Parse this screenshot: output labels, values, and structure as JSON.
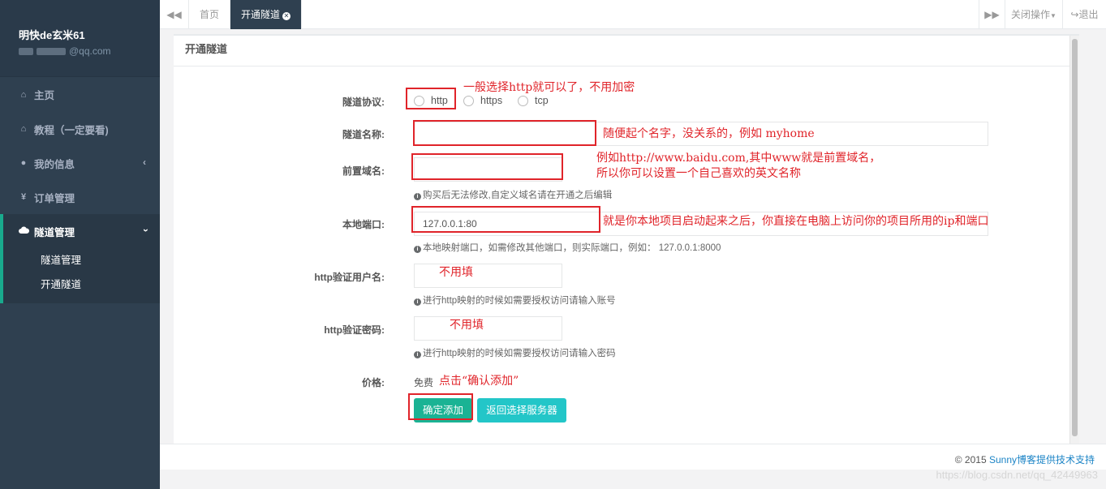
{
  "user": {
    "name": "明快de玄米61",
    "email_suffix": "@qq.com"
  },
  "sidebar": {
    "items": [
      {
        "label": "主页",
        "icon": "home-icon"
      },
      {
        "label": "教程（一定要看)",
        "icon": "home-icon"
      },
      {
        "label": "我的信息",
        "icon": "user-icon"
      },
      {
        "label": "订单管理",
        "icon": "yen-icon"
      },
      {
        "label": "隧道管理",
        "icon": "cloud-icon"
      }
    ],
    "sub_items": [
      {
        "label": "隧道管理"
      },
      {
        "label": "开通隧道"
      }
    ]
  },
  "topbar": {
    "tabs": [
      {
        "label": "首页"
      },
      {
        "label": "开通隧道"
      }
    ],
    "close_ops": "关闭操作",
    "logout": "退出"
  },
  "panel": {
    "title": "开通隧道"
  },
  "form": {
    "protocol": {
      "label": "隧道协议:",
      "options": [
        "http",
        "https",
        "tcp"
      ]
    },
    "name": {
      "label": "隧道名称:",
      "value": ""
    },
    "domain": {
      "label": "前置域名:",
      "value": "",
      "help": "购买后无法修改,自定义域名请在开通之后编辑"
    },
    "port": {
      "label": "本地端口:",
      "value": "127.0.0.1:80",
      "help": "本地映射端口，如需修改其他端口，则实际端口，例如：  127.0.0.1:8000"
    },
    "http_user": {
      "label": "http验证用户名:",
      "value": "",
      "help": "进行http映射的时候如需要授权访问请输入账号"
    },
    "http_pass": {
      "label": "http验证密码:",
      "value": "",
      "help": "进行http映射的时候如需要授权访问请输入密码"
    },
    "price": {
      "label": "价格:",
      "value": "免费"
    },
    "submit": "确定添加",
    "back": "返回选择服务器"
  },
  "annotations": {
    "protocol": "一般选择http就可以了，不用加密",
    "name": "随便起个名字，没关系的，例如 myhome",
    "domain_line1": "例如http://www.baidu.com,其中www就是前置域名，",
    "domain_line2": "所以你可以设置一个自己喜欢的英文名称",
    "port": "就是你本地项目启动起来之后，你直接在电脑上访问你的项目所用的ip和端口",
    "user": "不用填",
    "pass": "不用填",
    "submit": "点击“确认添加”"
  },
  "footer": {
    "copyright": "© 2015 ",
    "link": "Sunny博客提供技术支持"
  },
  "watermark": "https://blog.csdn.net/qq_42449963",
  "colors": {
    "sidebar": "#2f4050",
    "accent": "#1ab394",
    "info": "#23c6c8",
    "annotation": "#e0242a"
  }
}
